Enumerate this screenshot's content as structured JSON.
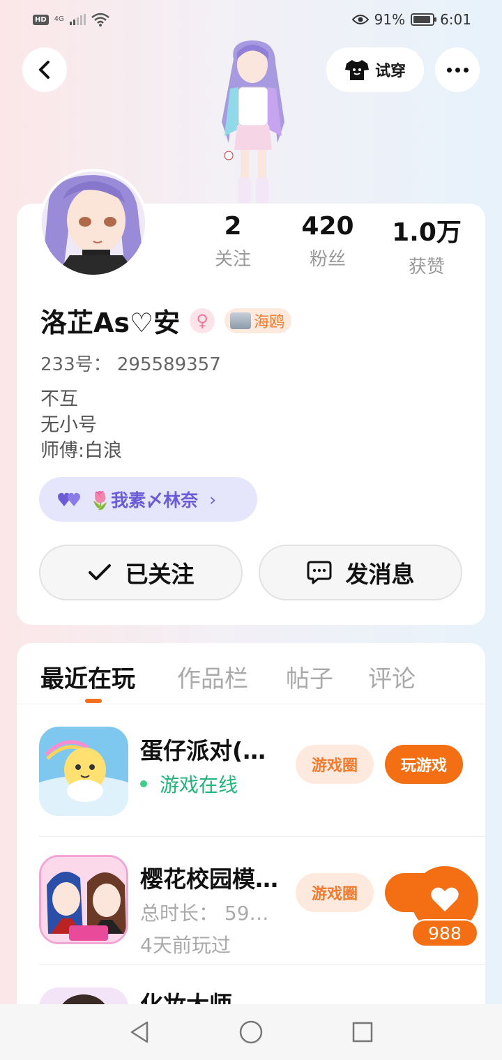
{
  "status_bar": {
    "hd": "HD",
    "network": "4G",
    "battery_percent": "91%",
    "time": "6:01",
    "battery_level": 0.91
  },
  "header": {
    "try_on_label": "试穿"
  },
  "profile": {
    "stats": [
      {
        "value": "2",
        "label": "关注"
      },
      {
        "value": "420",
        "label": "粉丝"
      },
      {
        "value": "1.0万",
        "label": "获赞"
      }
    ],
    "name": "洛芷As♡安",
    "gender_symbol": "♀",
    "tag_label": "海鸥",
    "uid": "233号：  295589357",
    "bio": [
      "不互",
      "无小号",
      "师傅:白浪"
    ],
    "relation_label": "🌷我素〆林奈",
    "follow_label": "已关注",
    "message_label": "发消息"
  },
  "tabs": [
    {
      "label": "最近在玩",
      "active": true
    },
    {
      "label": "作品栏",
      "active": false
    },
    {
      "label": "帖子",
      "active": false
    },
    {
      "label": "评论",
      "active": false
    }
  ],
  "games": [
    {
      "title": "蛋仔派对(…",
      "status": "游戏在线",
      "circle_label": "游戏圈",
      "play_label": "玩游戏"
    },
    {
      "title": "樱花校园模…",
      "duration": "总时长：  59…",
      "last_played": "4天前玩过",
      "circle_label": "游戏圈",
      "play_label": "玩"
    },
    {
      "title": "化妆大师"
    }
  ],
  "like": {
    "count": "988"
  },
  "colors": {
    "accent": "#f46e13",
    "relation": "#6b5bd6",
    "online": "#22b47a"
  }
}
